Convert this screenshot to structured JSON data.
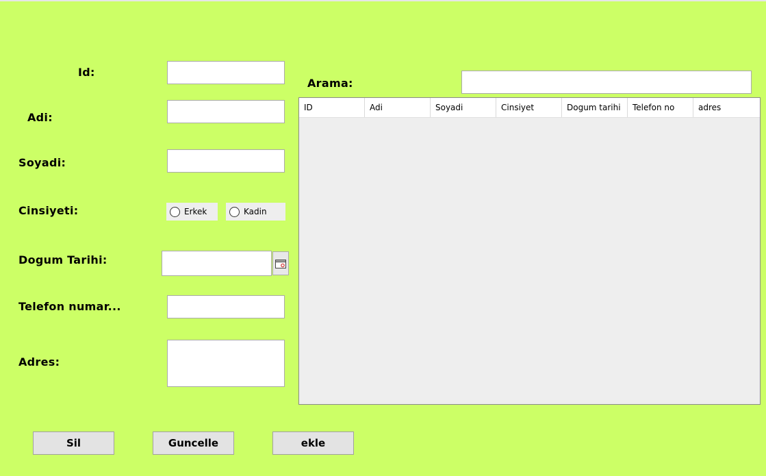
{
  "form": {
    "id_label": "Id:",
    "adi_label": "Adi:",
    "soyadi_label": "Soyadi:",
    "cinsiyeti_label": "Cinsiyeti:",
    "dogum_tarihi_label": "Dogum Tarihi:",
    "telefon_label": "Telefon numar...",
    "adres_label": "Adres:",
    "id_value": "",
    "adi_value": "",
    "soyadi_value": "",
    "dogum_tarihi_value": "",
    "telefon_value": "",
    "adres_value": "",
    "gender_options": [
      "Erkek",
      "Kadin"
    ]
  },
  "search": {
    "label": "Arama:",
    "value": ""
  },
  "table": {
    "columns": [
      "ID",
      "Adi",
      "Soyadi",
      "Cinsiyet",
      "Dogum tarihi",
      "Telefon no",
      "adres"
    ],
    "rows": []
  },
  "buttons": {
    "sil": "Sil",
    "guncelle": "Guncelle",
    "ekle": "ekle"
  },
  "colors": {
    "background": "#ccff66",
    "field": "#ffffff",
    "button": "#e3e3e3"
  },
  "icons": {
    "date_picker": "calendar-icon",
    "radio": "radio-unselected-icon"
  }
}
